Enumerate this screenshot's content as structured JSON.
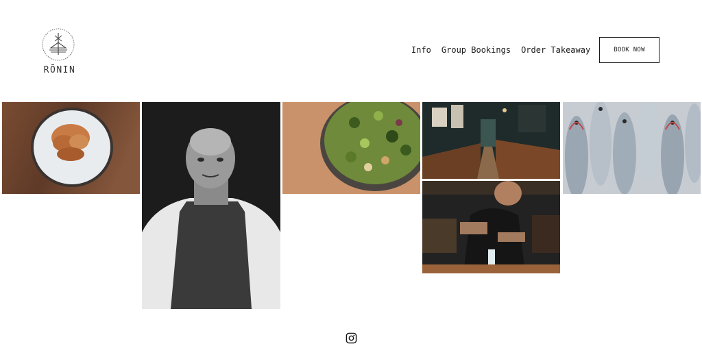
{
  "brand": {
    "name": "RŌNIN"
  },
  "nav": {
    "items": [
      {
        "label": "Info"
      },
      {
        "label": "Group Bookings"
      },
      {
        "label": "Order Takeaway"
      }
    ],
    "cta_label": "BOOK NOW"
  },
  "gallery": {
    "tiles": [
      {
        "name": "dish-on-ice-photo",
        "subject": "plated dish on crushed ice, wooden table"
      },
      {
        "name": "chef-portrait-photo",
        "subject": "black and white portrait of chef in apron"
      },
      {
        "name": "salad-bowl-photo",
        "subject": "bowl of green vegetables and olives"
      },
      {
        "name": "restaurant-interior-photo",
        "subject": "dimly lit bar interior with counter seating"
      },
      {
        "name": "bartender-photo",
        "subject": "bartender straining cocktail"
      },
      {
        "name": "fish-market-photo",
        "subject": "pile of fresh whole fish"
      }
    ]
  },
  "footer": {
    "social_icon": "instagram-icon"
  }
}
